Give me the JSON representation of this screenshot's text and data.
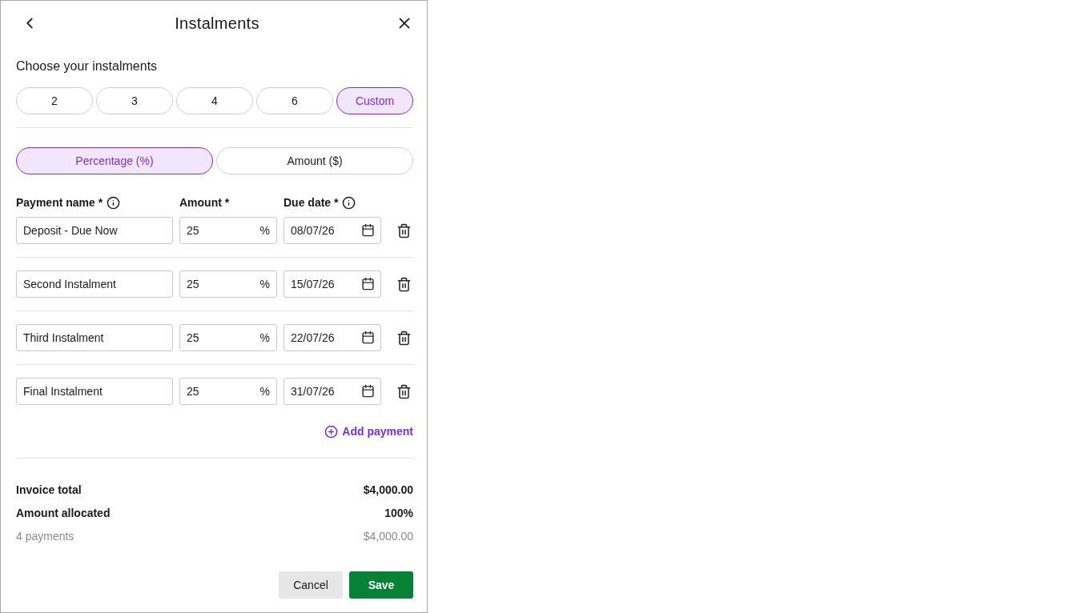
{
  "header": {
    "title": "Instalments"
  },
  "instalments": {
    "label": "Choose your instalments",
    "options": [
      {
        "label": "2",
        "selected": false
      },
      {
        "label": "3",
        "selected": false
      },
      {
        "label": "4",
        "selected": false
      },
      {
        "label": "6",
        "selected": false
      },
      {
        "label": "Custom",
        "selected": true
      }
    ]
  },
  "mode_toggle": [
    {
      "label": "Percentage (%)",
      "selected": true
    },
    {
      "label": "Amount ($)",
      "selected": false
    }
  ],
  "columns": [
    {
      "label": "Payment name *",
      "info": true
    },
    {
      "label": "Amount *",
      "info": false
    },
    {
      "label": "Due date *",
      "info": true
    }
  ],
  "payments": [
    {
      "name": "Deposit - Due Now",
      "amount": "25",
      "unit": "%",
      "due_date": "08/07/26"
    },
    {
      "name": "Second Instalment",
      "amount": "25",
      "unit": "%",
      "due_date": "15/07/26"
    },
    {
      "name": "Third Instalment",
      "amount": "25",
      "unit": "%",
      "due_date": "22/07/26"
    },
    {
      "name": "Final Instalment",
      "amount": "25",
      "unit": "%",
      "due_date": "31/07/26"
    }
  ],
  "add_payment": "Add payment",
  "summary": [
    {
      "label": "Invoice total",
      "value": "$4,000.00",
      "kind": "strong"
    },
    {
      "label": "Amount allocated",
      "value": "100%",
      "kind": "strong"
    },
    {
      "label": "4 payments",
      "value": "$4,000.00",
      "kind": "muted"
    }
  ],
  "buttons": [
    {
      "label": "Cancel",
      "kind": "secondary"
    },
    {
      "label": "Save",
      "kind": "primary"
    }
  ]
}
